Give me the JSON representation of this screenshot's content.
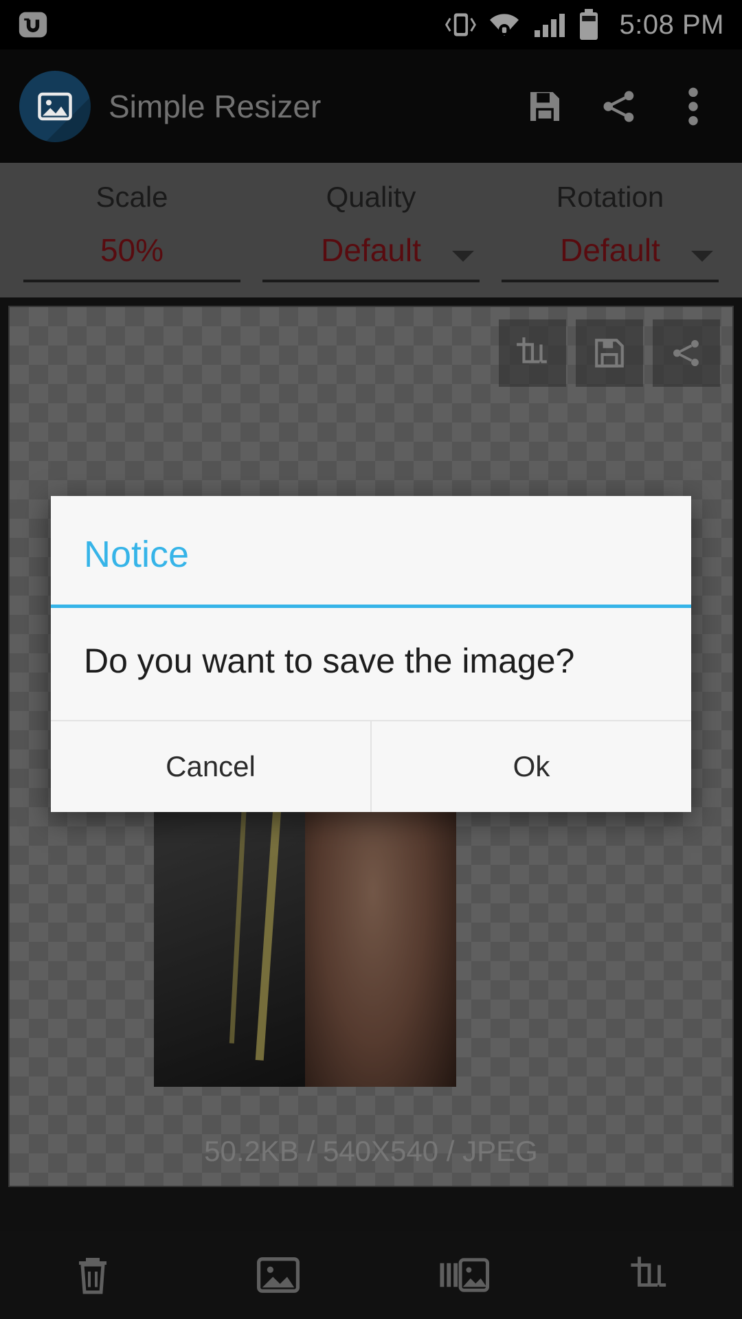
{
  "status_bar": {
    "clock": "5:08 PM",
    "icons": [
      "app-notification-icon",
      "vibrate-icon",
      "wifi-icon",
      "signal-icon",
      "battery-icon"
    ]
  },
  "app_bar": {
    "title": "Simple Resizer",
    "logo_icon": "image-app-logo-icon",
    "actions": [
      {
        "name": "save-button",
        "icon": "floppy-disk-icon"
      },
      {
        "name": "share-button",
        "icon": "share-icon"
      },
      {
        "name": "overflow-button",
        "icon": "more-vertical-icon"
      }
    ]
  },
  "options": [
    {
      "label": "Scale",
      "value": "50%",
      "has_caret": false
    },
    {
      "label": "Quality",
      "value": "Default",
      "has_caret": true
    },
    {
      "label": "Rotation",
      "value": "Default",
      "has_caret": true
    }
  ],
  "canvas": {
    "tools": [
      {
        "name": "crop-tool-button",
        "icon": "crop-icon"
      },
      {
        "name": "save-tool-button",
        "icon": "floppy-disk-icon"
      },
      {
        "name": "share-tool-button",
        "icon": "share-icon"
      }
    ],
    "image_info": "50.2KB / 540X540 / JPEG"
  },
  "dialog": {
    "title": "Notice",
    "message": "Do you want to save the image?",
    "cancel_label": "Cancel",
    "ok_label": "Ok",
    "accent_color": "#36b4e8"
  },
  "bottom_bar": [
    {
      "name": "delete-button",
      "icon": "trash-icon"
    },
    {
      "name": "gallery-button",
      "icon": "image-icon"
    },
    {
      "name": "batch-button",
      "icon": "multi-image-icon"
    },
    {
      "name": "crop-button",
      "icon": "crop-icon"
    }
  ],
  "colors": {
    "accent_red": "#8f1319",
    "dialog_accent": "#36b4e8",
    "options_bg": "#6e6e6e"
  }
}
